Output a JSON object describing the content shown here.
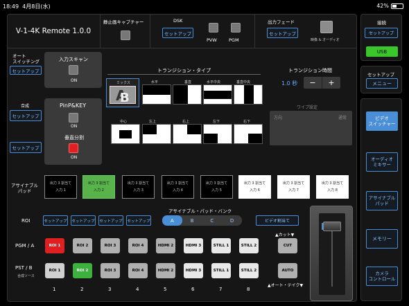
{
  "status": {
    "time": "18:49",
    "date": "4月8日(水)",
    "battery": "42%"
  },
  "app": {
    "title": "V-1-4K Remote 1.0.0"
  },
  "still": {
    "label": "静止画キャプチャー"
  },
  "dsk": {
    "label": "DSK",
    "setup": "セットアップ",
    "pvw": "PVW",
    "pgm": "PGM"
  },
  "fade": {
    "label": "出力フェード",
    "setup": "セットアップ",
    "mode": "映像 & オーディオ"
  },
  "auto_switch": {
    "label": "オート\nスイッチング",
    "setup": "セットアップ",
    "scan_label": "入力スキャン",
    "scan_state": "ON"
  },
  "compose": {
    "label": "合成",
    "setup": "セットアップ",
    "setup2": "セットアップ",
    "pinp": "PinP&KEY",
    "pinp_state": "ON",
    "split": "垂直分割",
    "split_state": "ON"
  },
  "transition": {
    "title": "トランジション・タイプ",
    "time_label": "トランジション時間",
    "time_value": "1.0 秒",
    "minus": "−",
    "plus": "+",
    "wipe_label": "ワイプ設定",
    "wipe_dir": "方向",
    "wipe_normal": "通常",
    "types_row1": [
      "ミックス",
      "水平",
      "垂直",
      "水平中央",
      "垂直中央"
    ],
    "types_row2": [
      "中心",
      "左上",
      "右上",
      "左下",
      "右下"
    ]
  },
  "assign": {
    "label": "アサイナブル\nパッド",
    "pads": [
      {
        "line1": "出力 3 割当て",
        "line2": "入力 1",
        "style": "black"
      },
      {
        "line1": "出力 3 割当て",
        "line2": "入力 2",
        "style": "green"
      },
      {
        "line1": "出力 3 割当て",
        "line2": "入力 3",
        "style": "black"
      },
      {
        "line1": "出力 3 割当て",
        "line2": "入力 4",
        "style": "black"
      },
      {
        "line1": "出力 3 割当て",
        "line2": "入力 5",
        "style": "black"
      },
      {
        "line1": "出力 3 割当て",
        "line2": "入力 6",
        "style": "white"
      },
      {
        "line1": "出力 3 割当て",
        "line2": "入力 7",
        "style": "white"
      },
      {
        "line1": "出力 3 割当て",
        "line2": "入力 8",
        "style": "white"
      }
    ],
    "bank_label": "アサイナブル・パッド・バンク",
    "banks": [
      "A",
      "B",
      "C",
      "D"
    ],
    "video_assign": "ビデオ割当て"
  },
  "roi": {
    "label": "ROI",
    "setups": [
      "セットアップ",
      "セットアップ",
      "セットアップ",
      "セットアップ"
    ]
  },
  "pgm": {
    "label": "PGM / A",
    "buttons": [
      "ROI 1",
      "ROI 2",
      "ROI 3",
      "ROI 4",
      "HDMI 2",
      "HDMI 3",
      "STILL 1",
      "STILL 2"
    ],
    "cut": "CUT",
    "cut_label": "▲カット▼"
  },
  "pst": {
    "label": "PST / B",
    "sublabel": "合成ソース",
    "buttons": [
      "ROI 1",
      "ROI 2",
      "ROI 3",
      "ROI 4",
      "HDMI 2",
      "HDMI 3",
      "STILL 1",
      "STILL 2"
    ],
    "auto": "AUTO",
    "auto_label": "▲オート・テイク▼"
  },
  "numbers": [
    "1",
    "2",
    "3",
    "4",
    "5",
    "6",
    "7",
    "8"
  ],
  "right": {
    "connect_label": "接続",
    "connect_setup": "セットアップ",
    "usb": "USB",
    "setup_label": "セットアップ",
    "menu": "メニュー",
    "video_switcher": "ビデオ\nスイッチャー",
    "audio_mixer": "オーディオ\nミキサー",
    "assignable_pad": "アサイナブル\nパッド",
    "memory": "メモリー",
    "camera": "カメラ\nコントロール"
  },
  "colors": {
    "accent": "#4a8ed8",
    "red": "#e02020",
    "green": "#3db13d",
    "usb": "#3bc62b"
  }
}
